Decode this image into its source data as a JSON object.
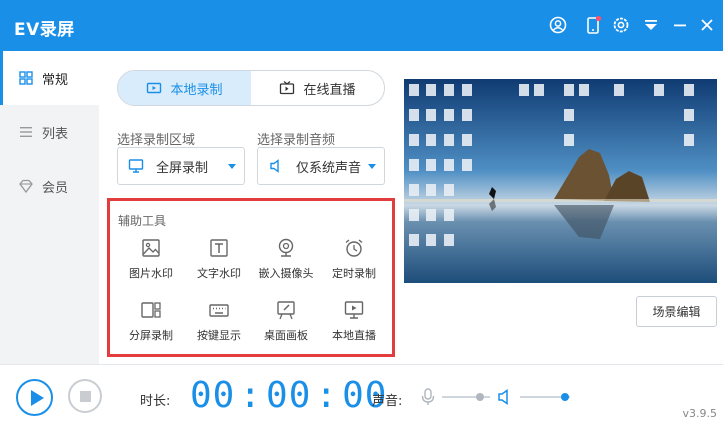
{
  "app": {
    "title": "EV录屏"
  },
  "titlebar": {
    "icons": [
      "user-icon",
      "phone-icon",
      "settings-icon",
      "dropdown-menu-icon",
      "minimize-icon",
      "close-icon"
    ]
  },
  "sidebar": {
    "items": [
      {
        "label": "常规",
        "icon": "grid-icon",
        "active": true
      },
      {
        "label": "列表",
        "icon": "list-icon",
        "active": false
      },
      {
        "label": "会员",
        "icon": "diamond-icon",
        "active": false
      }
    ]
  },
  "mode_tabs": [
    {
      "label": "本地录制",
      "icon": "video-icon",
      "active": true
    },
    {
      "label": "在线直播",
      "icon": "tv-icon",
      "active": false
    }
  ],
  "record_area": {
    "label": "选择录制区域",
    "value": "全屏录制",
    "icon": "monitor-icon"
  },
  "record_audio": {
    "label": "选择录制音频",
    "value": "仅系统声音",
    "icon": "speaker-icon"
  },
  "tools": {
    "title": "辅助工具",
    "items": [
      {
        "label": "图片水印",
        "icon": "image-icon"
      },
      {
        "label": "文字水印",
        "icon": "text-icon"
      },
      {
        "label": "嵌入摄像头",
        "icon": "webcam-icon"
      },
      {
        "label": "定时录制",
        "icon": "alarm-clock-icon"
      },
      {
        "label": "分屏录制",
        "icon": "split-screen-icon"
      },
      {
        "label": "按键显示",
        "icon": "keyboard-icon"
      },
      {
        "label": "桌面画板",
        "icon": "drawing-board-icon"
      },
      {
        "label": "本地直播",
        "icon": "monitor-play-icon"
      }
    ]
  },
  "preview": {
    "icon": "desktop-preview"
  },
  "scene_button": {
    "label": "场景编辑"
  },
  "bottom": {
    "duration_label": "时长:",
    "timer": {
      "h": "00",
      "m": "00",
      "s": "00",
      "sep": ":"
    },
    "sound_label": "声音:",
    "mic_volume": 0.8,
    "speaker_volume": 0.9,
    "version": "v3.9.5"
  },
  "colors": {
    "accent": "#1a8fe8",
    "highlight_box": "#e23c3c",
    "sidebar_bg": "#f2f3f5"
  }
}
